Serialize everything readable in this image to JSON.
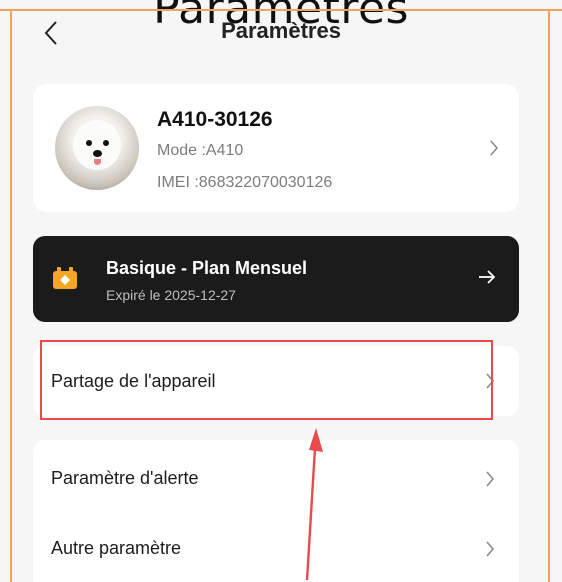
{
  "overlay": {
    "partial_title": "Paramètres"
  },
  "header": {
    "title": "Paramètres"
  },
  "device": {
    "name": "A410-30126",
    "mode": "Mode :A410",
    "imei": "IMEI :868322070030126"
  },
  "plan": {
    "title": "Basique - Plan Mensuel",
    "expiry": "Expiré le 2025-12-27"
  },
  "share": {
    "label": "Partage de l'appareil"
  },
  "settings": {
    "items": [
      {
        "label": "Paramètre d'alerte"
      },
      {
        "label": "Autre paramètre"
      }
    ]
  },
  "colors": {
    "accent": "#f5a623",
    "highlight": "#e84a4d",
    "banner": "#1b1b1b",
    "guide": "#f0a35a"
  },
  "icons": {
    "back": "chevron-left-icon",
    "chevron": "chevron-right-icon",
    "plan": "camera-badge-icon",
    "arrow": "arrow-right-icon"
  }
}
